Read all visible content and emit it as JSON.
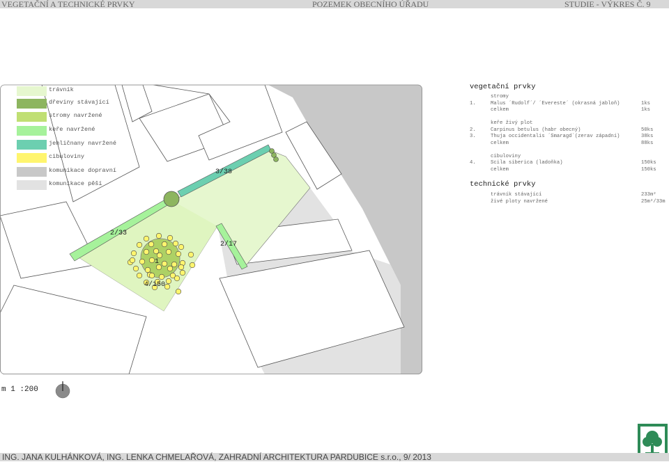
{
  "header": {
    "left": "VEGETAČNÍ A TECHNICKÉ PRVKY",
    "center": "POZEMEK OBECNÍHO ÚŘADU",
    "right": "STUDIE - VÝKRES Č. 9"
  },
  "legend": [
    {
      "label": "trávník",
      "color": "#e6f7cf"
    },
    {
      "label": "dřeviny stávající",
      "color": "#8db55f"
    },
    {
      "label": "stromy navržené",
      "color": "#c0df73"
    },
    {
      "label": "keře navržené",
      "color": "#a6f29b"
    },
    {
      "label": "jehličnany navržené",
      "color": "#6ccfb0"
    },
    {
      "label": "cibuloviny",
      "color": "#fff56e"
    },
    {
      "label": "komunikace dopravní",
      "color": "#c8c8c8"
    },
    {
      "label": "komunikace pěší",
      "color": "#e2e2e2"
    }
  ],
  "plan_labels": {
    "parcel_a": "3/38",
    "parcel_b": "2/33",
    "parcel_c": "2/17",
    "parcel_d": "4/150",
    "tree_number": "1"
  },
  "vegetation": {
    "title": "vegetační prvky",
    "groups": [
      {
        "heading": "stromy",
        "items": [
          {
            "num": "1.",
            "name": "Malus ´Rudolf´/ ´Evereste´ (okrasná jabloň)",
            "qty": "1ks"
          },
          {
            "num": "",
            "name": "celkem",
            "qty": "1ks"
          }
        ]
      },
      {
        "heading": "keře živý plot",
        "items": [
          {
            "num": "2.",
            "name": "Carpinus betulus (habr obecný)",
            "qty": "50ks"
          },
          {
            "num": "3.",
            "name": "Thuja occidentalis ´Smaragd´(zerav západní)",
            "qty": "38ks"
          },
          {
            "num": "",
            "name": "celkem",
            "qty": "88ks"
          }
        ]
      },
      {
        "heading": "cibuloviny",
        "items": [
          {
            "num": "4.",
            "name": "Scila siberica (ladoňka)",
            "qty": "150ks"
          },
          {
            "num": "",
            "name": "celkem",
            "qty": "150ks"
          }
        ]
      }
    ]
  },
  "technical": {
    "title": "technické prvky",
    "items": [
      {
        "name": "trávník stávající",
        "qty": "233m²"
      },
      {
        "name": "živé ploty navržené",
        "qty": "25m²/33m"
      }
    ]
  },
  "scale": "m 1 :200",
  "footer": "ING. JANA KULHÁNKOVÁ, ING. LENKA CHMELAŘOVÁ, ZAHRADNÍ ARCHITEKTURA PARDUBICE s.r.o., 9/ 2013",
  "colors": {
    "road": "#c8c8c8",
    "path": "#e2e2e2",
    "lawn": "#e6f7cf",
    "hedge": "#a6f29b",
    "thuja": "#6ccfb0",
    "bulbs": "#fff56e",
    "tree": "#c0df73",
    "existing": "#8db55f",
    "logo": "#2e8b57"
  }
}
